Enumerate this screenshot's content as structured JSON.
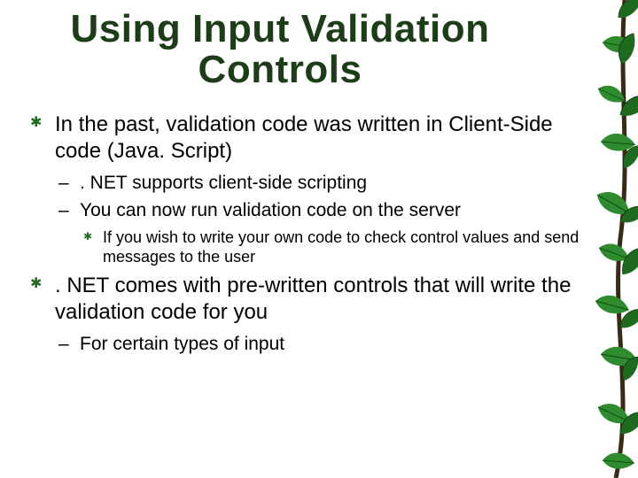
{
  "title": "Using Input Validation Controls",
  "bullets": {
    "b1": "In the past, validation code was written in Client-Side code (Java. Script)",
    "b1_sub1": ". NET supports client-side scripting",
    "b1_sub2": "You can now run validation code on the server",
    "b1_sub2_sub1": "If you wish to write your own code to check control values and send messages to the user",
    "b2": ". NET comes with pre-written controls that will write the validation code for you",
    "b2_sub1": "For certain types of input"
  }
}
